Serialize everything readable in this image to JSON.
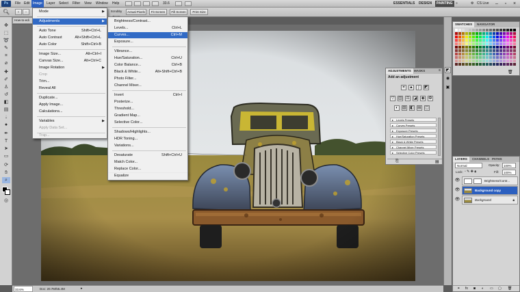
{
  "menubar": {
    "app_icon": "Ps",
    "items": [
      "File",
      "Edit",
      "Image",
      "Layer",
      "Select",
      "Filter",
      "View",
      "Window",
      "Help"
    ],
    "zoom": "33.6",
    "workspaces": [
      "ESSENTIALS",
      "DESIGN",
      "PAINTING"
    ],
    "cs_live": "CS Live"
  },
  "options": {
    "buttons": [
      "Fit Screen",
      "Actual Pixels",
      "Fit Screen",
      "Fill Screen",
      "Print Size"
    ],
    "zoom_all_label": "Zoom All Windows",
    "scrubby_label": "Scrubby Zoom"
  },
  "document": {
    "tab_title": "How-to-edi",
    "status_zoom": "33.6%",
    "status_doc": "Doc: 20.7M/55.4M"
  },
  "image_menu": {
    "items": [
      {
        "label": "Mode",
        "shortcut": "",
        "submenu": true
      },
      {
        "label": "Adjustments",
        "shortcut": "",
        "submenu": true,
        "active": true
      },
      {
        "label": "Auto Tone",
        "shortcut": "Shift+Ctrl+L"
      },
      {
        "label": "Auto Contrast",
        "shortcut": "Alt+Shift+Ctrl+L"
      },
      {
        "label": "Auto Color",
        "shortcut": "Shift+Ctrl+B"
      },
      {
        "label": "Image Size...",
        "shortcut": "Alt+Ctrl+I"
      },
      {
        "label": "Canvas Size...",
        "shortcut": "Alt+Ctrl+C"
      },
      {
        "label": "Image Rotation",
        "shortcut": "",
        "submenu": true
      },
      {
        "label": "Crop",
        "shortcut": "",
        "disabled": true
      },
      {
        "label": "Trim...",
        "shortcut": ""
      },
      {
        "label": "Reveal All",
        "shortcut": ""
      },
      {
        "label": "Duplicate...",
        "shortcut": ""
      },
      {
        "label": "Apply Image...",
        "shortcut": ""
      },
      {
        "label": "Calculations...",
        "shortcut": ""
      },
      {
        "label": "Variables",
        "shortcut": "",
        "submenu": true
      },
      {
        "label": "Apply Data Set...",
        "shortcut": "",
        "disabled": true
      },
      {
        "label": "Trap...",
        "shortcut": "",
        "disabled": true
      }
    ]
  },
  "adjust_menu": {
    "items": [
      {
        "label": "Brightness/Contrast...",
        "shortcut": ""
      },
      {
        "label": "Levels...",
        "shortcut": "Ctrl+L"
      },
      {
        "label": "Curves...",
        "shortcut": "Ctrl+M",
        "active": true
      },
      {
        "label": "Exposure...",
        "shortcut": ""
      },
      {
        "label": "Vibrance...",
        "shortcut": ""
      },
      {
        "label": "Hue/Saturation...",
        "shortcut": "Ctrl+U"
      },
      {
        "label": "Color Balance...",
        "shortcut": "Ctrl+B"
      },
      {
        "label": "Black & White...",
        "shortcut": "Alt+Shift+Ctrl+B"
      },
      {
        "label": "Photo Filter...",
        "shortcut": ""
      },
      {
        "label": "Channel Mixer...",
        "shortcut": ""
      },
      {
        "label": "Invert",
        "shortcut": "Ctrl+I"
      },
      {
        "label": "Posterize...",
        "shortcut": ""
      },
      {
        "label": "Threshold...",
        "shortcut": ""
      },
      {
        "label": "Gradient Map...",
        "shortcut": ""
      },
      {
        "label": "Selective Color...",
        "shortcut": ""
      },
      {
        "label": "Shadows/Highlights...",
        "shortcut": ""
      },
      {
        "label": "HDR Toning...",
        "shortcut": ""
      },
      {
        "label": "Variations...",
        "shortcut": ""
      },
      {
        "label": "Desaturate",
        "shortcut": "Shift+Ctrl+U"
      },
      {
        "label": "Match Color...",
        "shortcut": ""
      },
      {
        "label": "Replace Color...",
        "shortcut": ""
      },
      {
        "label": "Equalize",
        "shortcut": ""
      }
    ]
  },
  "adjustments_panel": {
    "tabs": [
      "ADJUSTMENTS",
      "MASKS"
    ],
    "heading": "Add an adjustment",
    "presets": [
      "Levels Presets",
      "Curves Presets",
      "Exposure Presets",
      "Hue/Saturation Presets",
      "Black & White Presets",
      "Channel Mixer Presets",
      "Selective Color Presets"
    ]
  },
  "swatches_panel": {
    "tabs": [
      "SWATCHES",
      "NAVIGATOR"
    ]
  },
  "layers_panel": {
    "tabs": [
      "LAYERS",
      "CHANNELS",
      "PATHS"
    ],
    "blend_mode": "Normal",
    "opacity_label": "Opacity:",
    "opacity_value": "100%",
    "lock_label": "Lock:",
    "fill_label": "Fill:",
    "fill_value": "100%",
    "layers": [
      {
        "name": "Brightness/Contr...",
        "selected": false
      },
      {
        "name": "Background copy",
        "selected": true
      },
      {
        "name": "Background",
        "selected": false
      }
    ]
  },
  "colors": {
    "menu_highlight": "#316ac5",
    "layer_selected": "#2b5fbf",
    "panel_bg": "#d4d4d4",
    "canvas_bg": "#6d6d6d"
  }
}
